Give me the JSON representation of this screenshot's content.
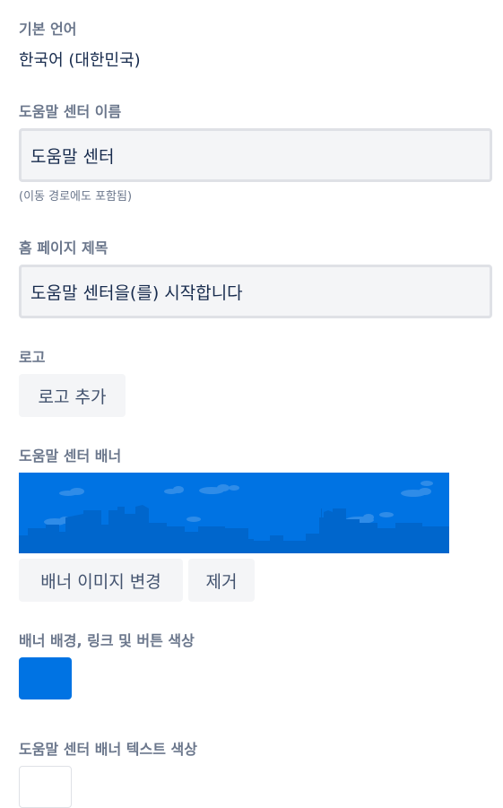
{
  "default_language": {
    "label": "기본 언어",
    "value": "한국어 (대한민국)"
  },
  "help_center_name": {
    "label": "도움말 센터 이름",
    "value": "도움말 센터",
    "hint": "(이동 경로에도 포함됨)"
  },
  "home_page_title": {
    "label": "홈 페이지 제목",
    "value": "도움말 센터을(를) 시작합니다"
  },
  "logo": {
    "label": "로고",
    "add_button": "로고 추가"
  },
  "banner": {
    "label": "도움말 센터 배너",
    "change_button": "배너 이미지 변경",
    "remove_button": "제거",
    "image_icon": "city-skyline-banner"
  },
  "banner_color": {
    "label": "배너 배경, 링크 및 버튼 색상",
    "color": "#0073e3"
  },
  "banner_text_color": {
    "label": "도움말 센터 배너 텍스트 색상",
    "color": "#ffffff"
  }
}
